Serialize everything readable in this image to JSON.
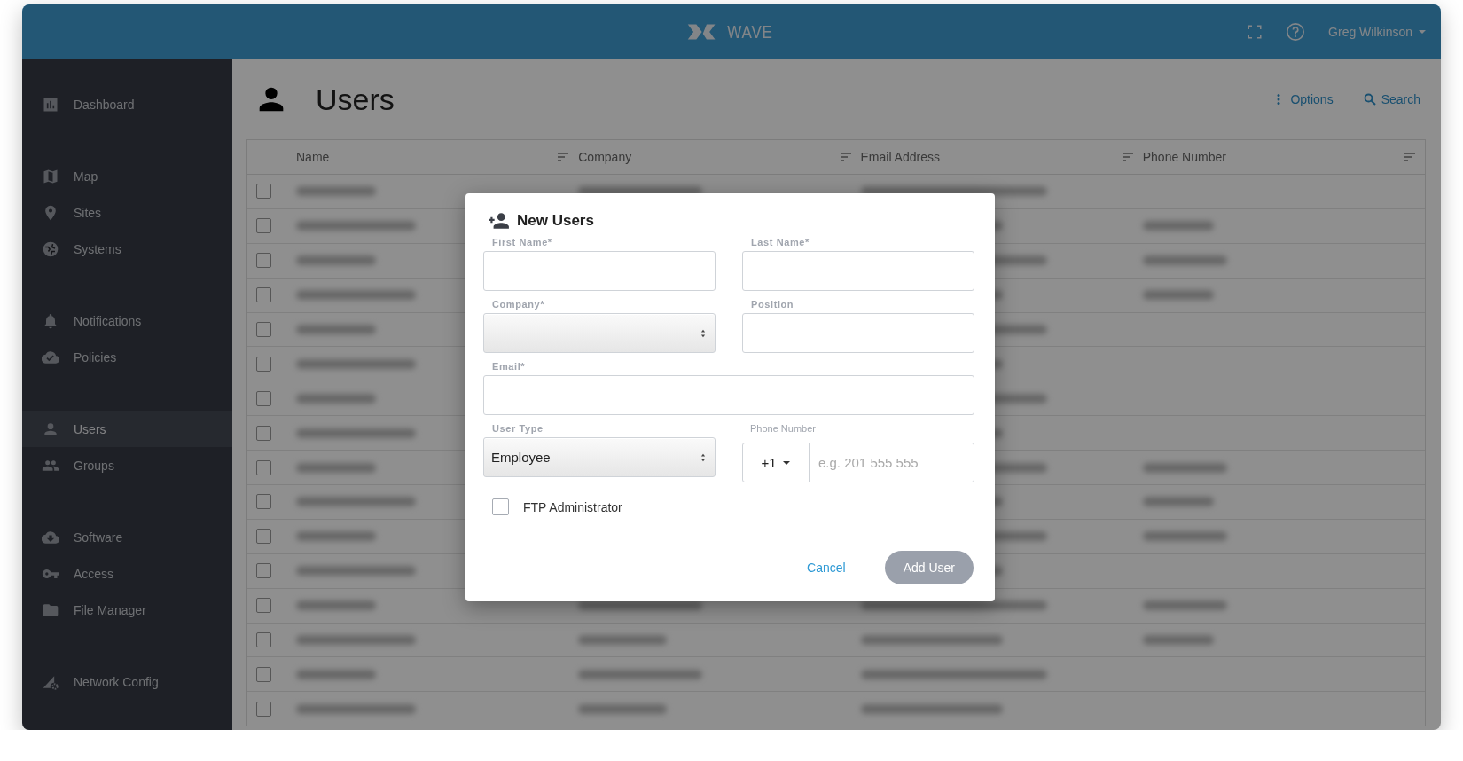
{
  "header": {
    "logo_text": "WAVE",
    "user_name": "Greg Wilkinson"
  },
  "sidebar": {
    "sections": [
      [
        {
          "label": "Dashboard",
          "selected": false
        }
      ],
      [
        {
          "label": "Map",
          "selected": false
        },
        {
          "label": "Sites",
          "selected": false
        },
        {
          "label": "Systems",
          "selected": false
        }
      ],
      [
        {
          "label": "Notifications",
          "selected": false
        },
        {
          "label": "Policies",
          "selected": false
        }
      ],
      [
        {
          "label": "Users",
          "selected": true
        },
        {
          "label": "Groups",
          "selected": false
        }
      ],
      [
        {
          "label": "Software",
          "selected": false
        },
        {
          "label": "Access",
          "selected": false
        },
        {
          "label": "File Manager",
          "selected": false
        }
      ],
      [
        {
          "label": "Network Config",
          "selected": false
        }
      ]
    ]
  },
  "page": {
    "title": "Users",
    "actions": [
      {
        "kind": "options",
        "label": "Options"
      },
      {
        "kind": "search",
        "label": "Search"
      }
    ]
  },
  "table": {
    "columns": [
      "Name",
      "Company",
      "Email Address",
      "Phone Number"
    ],
    "rows": [
      {
        "checked": false,
        "phone_shown": false
      },
      {
        "checked": false,
        "phone_shown": true
      },
      {
        "checked": false,
        "phone_shown": true
      },
      {
        "checked": false,
        "phone_shown": true
      },
      {
        "checked": false,
        "phone_shown": false
      },
      {
        "checked": false,
        "phone_shown": false
      },
      {
        "checked": false,
        "phone_shown": false
      },
      {
        "checked": false,
        "phone_shown": false
      },
      {
        "checked": false,
        "phone_shown": true
      },
      {
        "checked": false,
        "phone_shown": true
      },
      {
        "checked": false,
        "phone_shown": true
      },
      {
        "checked": false,
        "phone_shown": false
      },
      {
        "checked": false,
        "phone_shown": true
      },
      {
        "checked": false,
        "phone_shown": true
      },
      {
        "checked": false,
        "phone_shown": false
      },
      {
        "checked": false,
        "phone_shown": false
      }
    ]
  },
  "dialog": {
    "title": "New Users",
    "fields": [
      {
        "kind": "text",
        "label": "First Name*"
      },
      {
        "kind": "text",
        "label": "Last Name*"
      },
      {
        "kind": "select",
        "label": "Company*"
      },
      {
        "kind": "text",
        "label": "Position"
      },
      {
        "kind": "email",
        "label": "Email*"
      },
      {
        "kind": "select",
        "label": "User Type",
        "value": "Employee"
      },
      {
        "kind": "phone",
        "label": "Phone Number",
        "country_code": "+1",
        "placeholder": "e.g. 201 555 555"
      }
    ],
    "checkbox": {
      "label": "FTP Administrator",
      "checked": false
    },
    "buttons": [
      {
        "kind": "link",
        "label": "Cancel",
        "disabled": false
      },
      {
        "kind": "primary",
        "label": "Add User",
        "disabled": true
      }
    ]
  }
}
